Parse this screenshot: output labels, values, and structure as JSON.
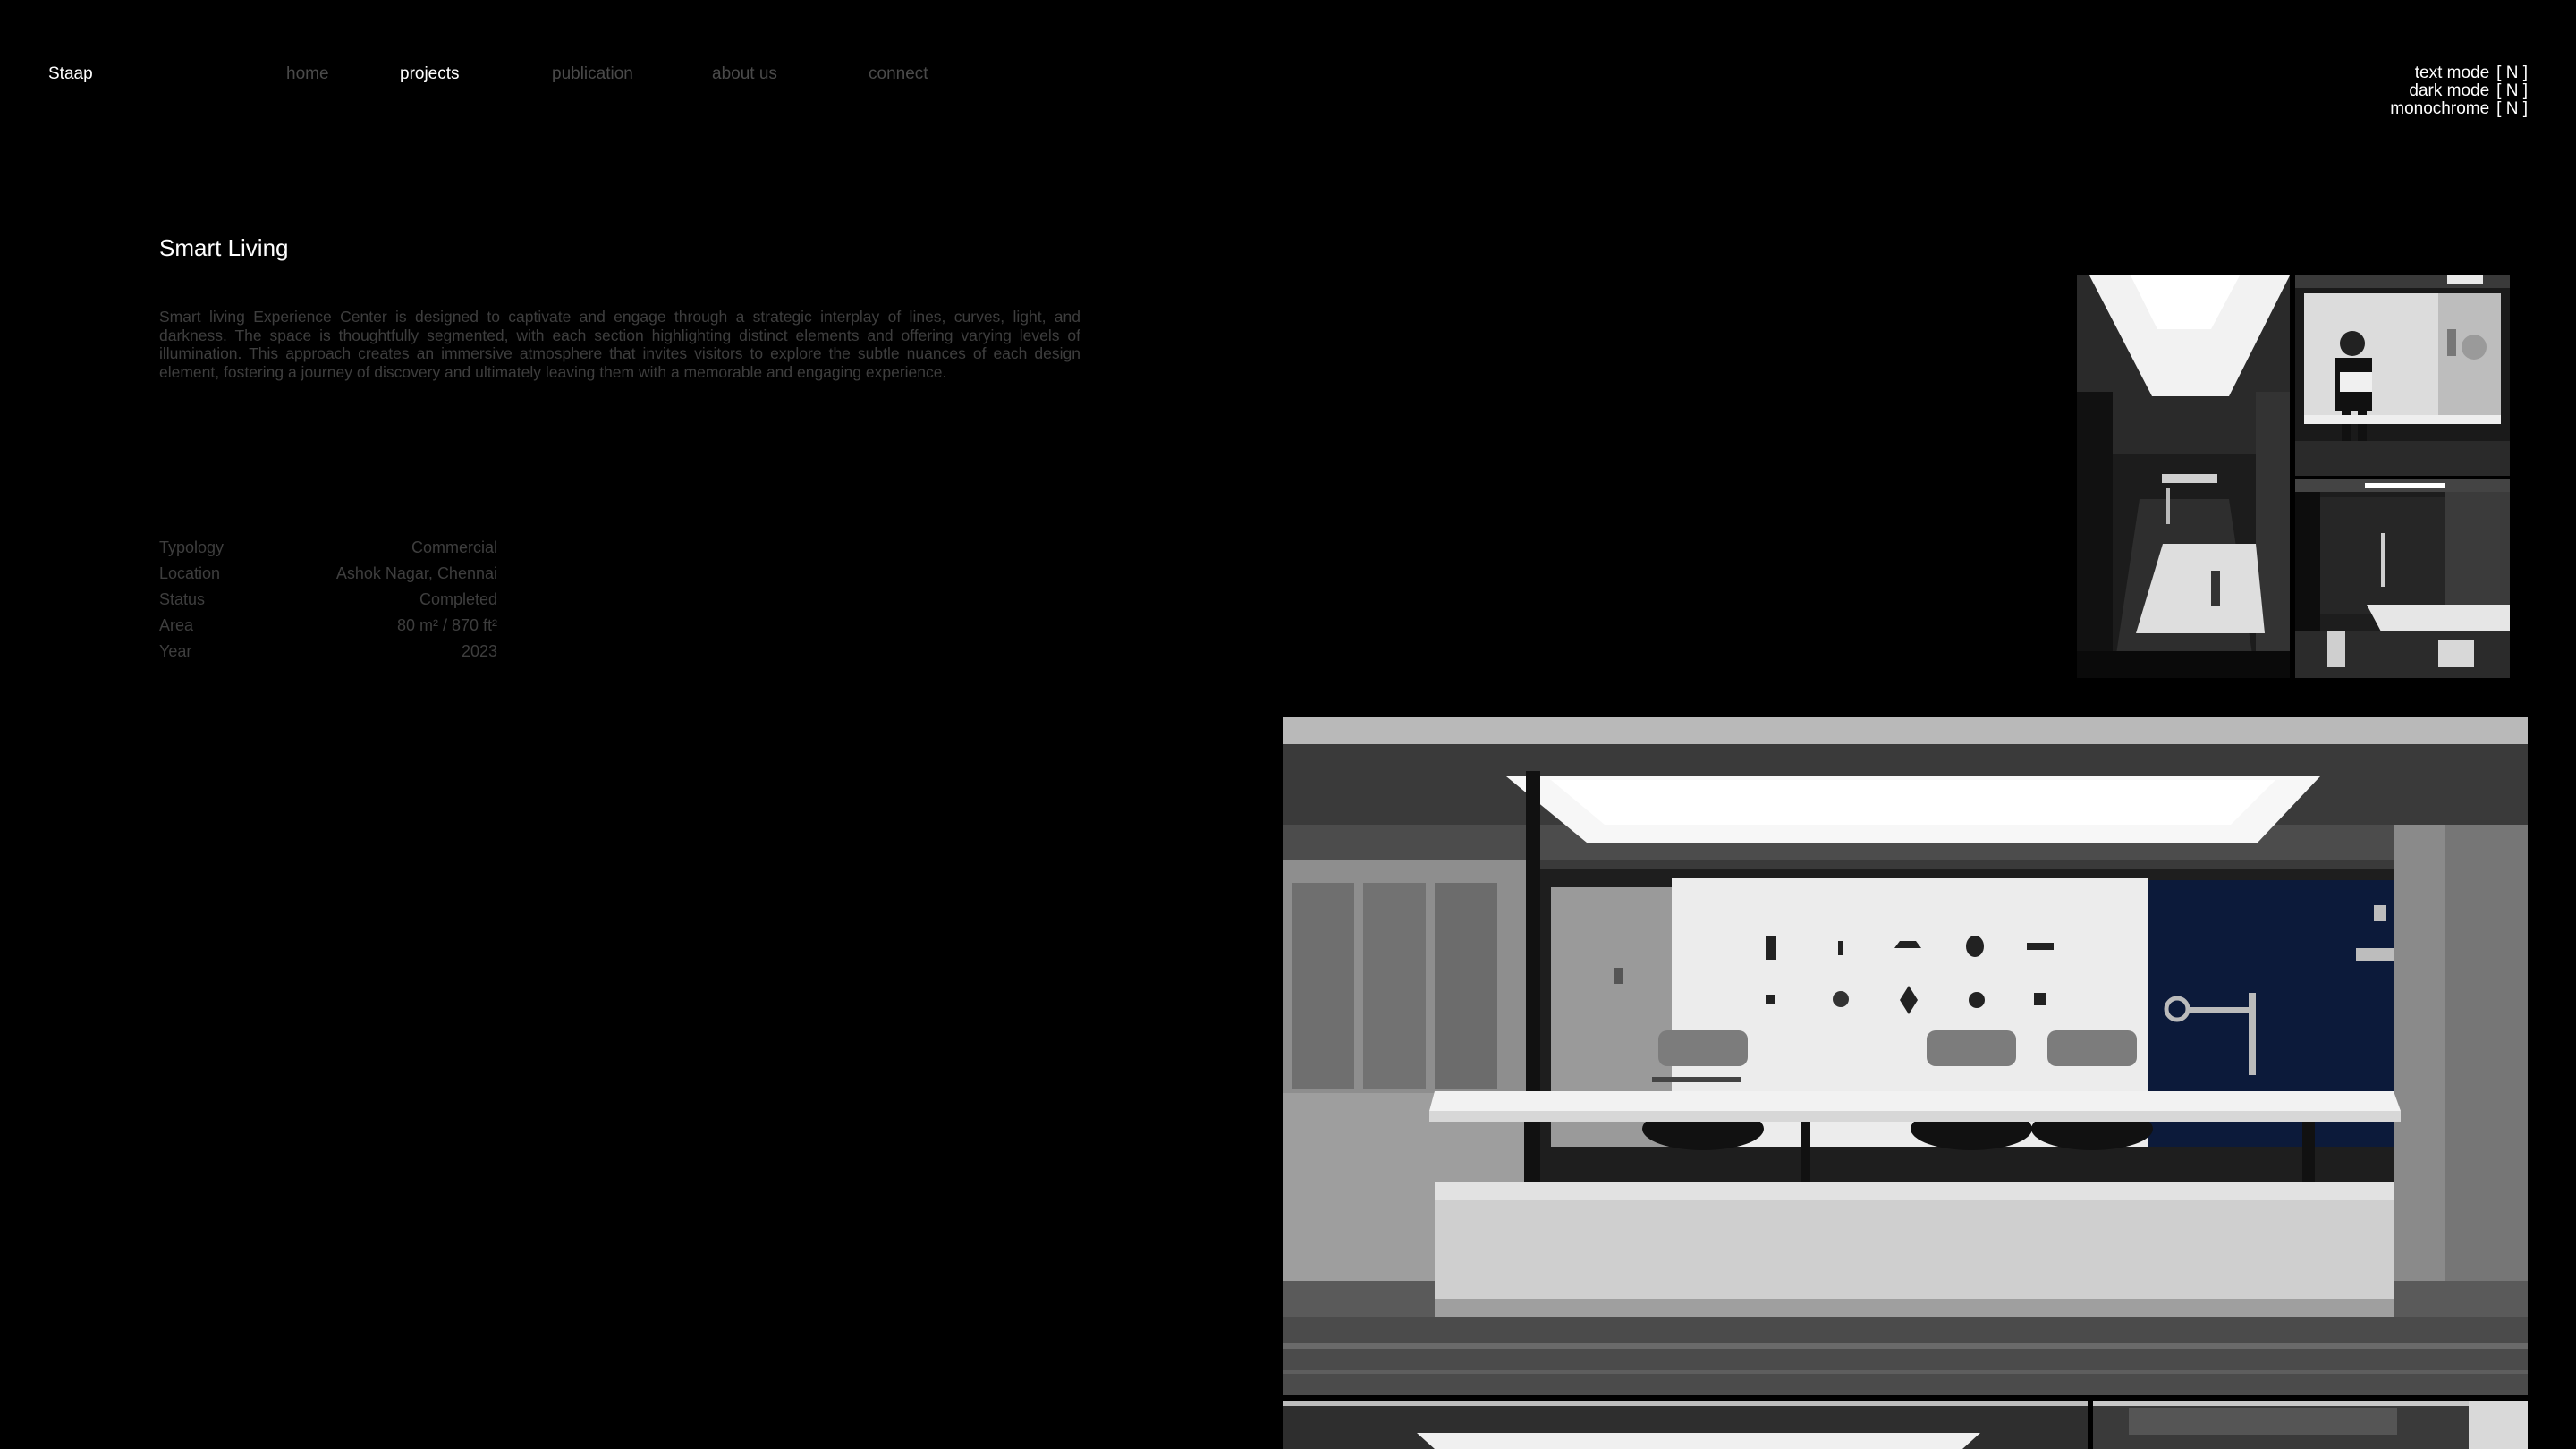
{
  "header": {
    "brand": "Staap",
    "nav": [
      {
        "label": "home",
        "active": false
      },
      {
        "label": "projects",
        "active": true
      },
      {
        "label": "publication",
        "active": false
      },
      {
        "label": "about us",
        "active": false
      },
      {
        "label": "connect",
        "active": false
      }
    ],
    "modes": [
      {
        "label": "text mode",
        "flag": "[ N ]"
      },
      {
        "label": "dark mode",
        "flag": "[ N ]"
      },
      {
        "label": "monochrome",
        "flag": "[ N ]"
      }
    ]
  },
  "project": {
    "title": "Smart Living",
    "description": "Smart living Experience Center is designed to captivate and engage through a strategic interplay of lines, curves, light, and darkness. The space is thoughtfully segmented, with each section highlighting distinct elements and offering varying levels of illumination. This approach creates an immersive atmosphere that invites visitors to explore the subtle nuances of each design element, fostering a journey of discovery and ultimately leaving them with a memorable and engaging experience.",
    "specs": [
      {
        "label": "Typology",
        "value": "Commercial"
      },
      {
        "label": "Location",
        "value": "Ashok Nagar, Chennai"
      },
      {
        "label": "Status",
        "value": "Completed"
      },
      {
        "label": "Area",
        "value": "80 m² / 870 ft²"
      },
      {
        "label": "Year",
        "value": "2023"
      }
    ]
  },
  "colors": {
    "background": "#000000",
    "text_primary": "#ffffff",
    "text_muted": "#4a4a4a",
    "text_dim": "#3e3e3e",
    "accent_panel": "#0c1a3a"
  }
}
